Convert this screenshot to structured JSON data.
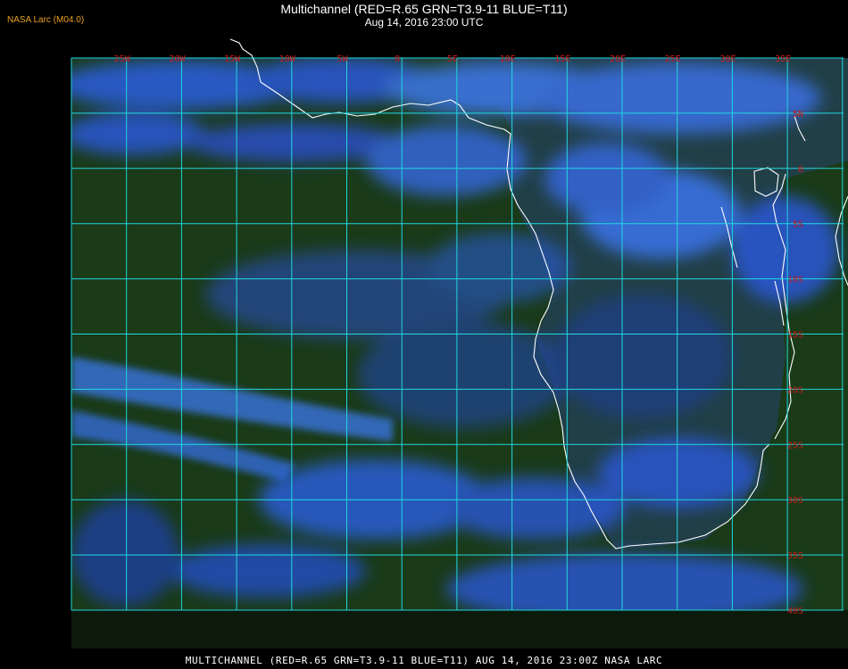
{
  "header": {
    "source_label": "NASA Larc (M04.0)",
    "title": "Multichannel (RED=R.65 GRN=T3.9-11 BLUE=T11)",
    "datetime": "Aug 14, 2016 23:00 UTC"
  },
  "footer": {
    "caption": "MULTICHANNEL (RED=R.65 GRN=T3.9-11 BLUE=T11) AUG 14, 2016 23:00Z   NASA LARC"
  },
  "map": {
    "longitude_labels": [
      "25W",
      "20W",
      "15W",
      "10W",
      "5W",
      "0",
      "5E",
      "10E",
      "15E",
      "20E",
      "25E",
      "30E",
      "35E"
    ],
    "latitude_labels": [
      "5N",
      "0",
      "5S",
      "10S",
      "15S",
      "20S",
      "25S",
      "30S",
      "35S",
      "40S"
    ],
    "colors": {
      "grid": "#20d8e0",
      "label": "#d01818",
      "coast": "#ffffff",
      "ocean": "#1a3a18",
      "cloud": "#2a58d8"
    }
  }
}
